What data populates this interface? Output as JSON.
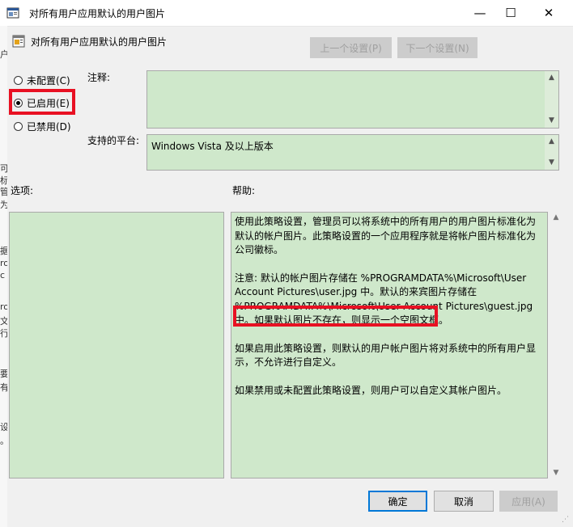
{
  "window": {
    "title": "对所有用户应用默认的用户图片",
    "minimize_glyph": "—",
    "maximize_glyph": "☐",
    "close_glyph": "✕"
  },
  "background_strip": [
    "户",
    "可",
    "标",
    "管",
    "为",
    "据",
    "ro",
    "c",
    "ro",
    "文",
    "行",
    "要",
    "有",
    "设",
    "。"
  ],
  "header": {
    "policy_name": "对所有用户应用默认的用户图片",
    "prev_setting": "上一个设置(P)",
    "next_setting": "下一个设置(N)"
  },
  "state": {
    "options": [
      {
        "label": "未配置(C)",
        "selected": false
      },
      {
        "label": "已启用(E)",
        "selected": true
      },
      {
        "label": "已禁用(D)",
        "selected": false
      }
    ]
  },
  "fields": {
    "comment_label": "注释:",
    "comment_value": "",
    "platform_label": "支持的平台:",
    "platform_value": "Windows Vista 及以上版本"
  },
  "panes": {
    "options_label": "选项:",
    "help_label": "帮助:",
    "help_paragraphs": [
      "使用此策略设置，管理员可以将系统中的所有用户的用户图片标准化为默认的帐户图片。此策略设置的一个应用程序就是将帐户图片标准化为公司徽标。",
      "注意: 默认的帐户图片存储在 %PROGRAMDATA%\\Microsoft\\User Account Pictures\\user.jpg 中。默认的来宾图片存储在 %PROGRAMDATA%\\Microsoft\\User Account Pictures\\guest.jpg 中。如果默认图片不存在，则显示一个空图文框。",
      "如果启用此策略设置，则默认的用户帐户图片将对系统中的所有用户显示，不允许进行自定义。",
      "如果禁用或未配置此策略设置，则用户可以自定义其帐户图片。"
    ]
  },
  "footer": {
    "ok": "确定",
    "cancel": "取消",
    "apply": "应用(A)"
  },
  "colors": {
    "pane_green": "#cfe8cb",
    "highlight_red": "#e81123",
    "default_button_blue": "#0078d7"
  }
}
